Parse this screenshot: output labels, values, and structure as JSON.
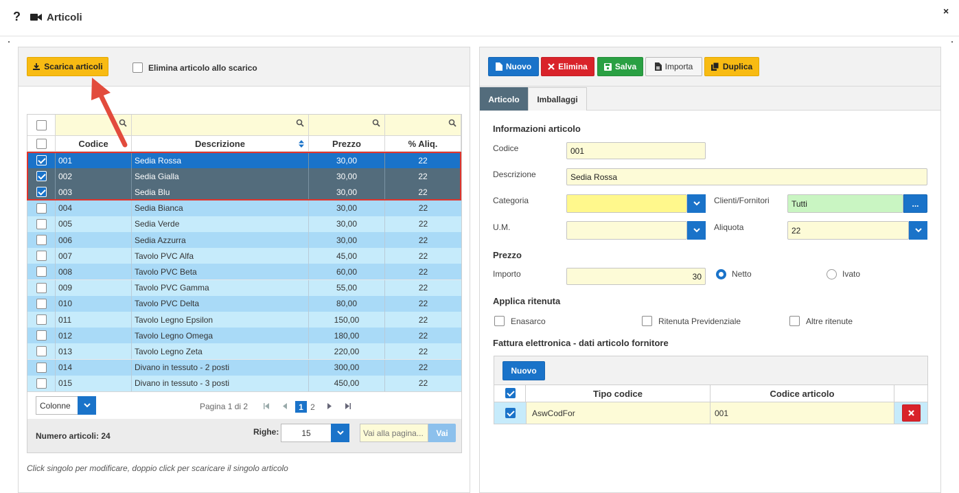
{
  "window": {
    "title": "Articoli",
    "help_label": "?",
    "close_label": "×"
  },
  "left": {
    "download_button": "Scarica articoli",
    "delete_on_download_label": "Elimina articolo allo scarico",
    "columns": {
      "code": "Codice",
      "description": "Descrizione",
      "price": "Prezzo",
      "vat": "% Aliq."
    },
    "rows": [
      {
        "code": "001",
        "description": "Sedia Rossa",
        "price": "30,00",
        "vat": "22",
        "checked": true
      },
      {
        "code": "002",
        "description": "Sedia Gialla",
        "price": "30,00",
        "vat": "22",
        "checked": true
      },
      {
        "code": "003",
        "description": "Sedia Blu",
        "price": "30,00",
        "vat": "22",
        "checked": true
      },
      {
        "code": "004",
        "description": "Sedia Bianca",
        "price": "30,00",
        "vat": "22",
        "checked": false
      },
      {
        "code": "005",
        "description": "Sedia Verde",
        "price": "30,00",
        "vat": "22",
        "checked": false
      },
      {
        "code": "006",
        "description": "Sedia Azzurra",
        "price": "30,00",
        "vat": "22",
        "checked": false
      },
      {
        "code": "007",
        "description": "Tavolo PVC Alfa",
        "price": "45,00",
        "vat": "22",
        "checked": false
      },
      {
        "code": "008",
        "description": "Tavolo PVC Beta",
        "price": "60,00",
        "vat": "22",
        "checked": false
      },
      {
        "code": "009",
        "description": "Tavolo PVC Gamma",
        "price": "55,00",
        "vat": "22",
        "checked": false
      },
      {
        "code": "010",
        "description": "Tavolo PVC Delta",
        "price": "80,00",
        "vat": "22",
        "checked": false
      },
      {
        "code": "011",
        "description": "Tavolo Legno Epsilon",
        "price": "150,00",
        "vat": "22",
        "checked": false
      },
      {
        "code": "012",
        "description": "Tavolo Legno Omega",
        "price": "180,00",
        "vat": "22",
        "checked": false
      },
      {
        "code": "013",
        "description": "Tavolo Legno Zeta",
        "price": "220,00",
        "vat": "22",
        "checked": false
      },
      {
        "code": "014",
        "description": "Divano in tessuto - 2 posti",
        "price": "300,00",
        "vat": "22",
        "checked": false
      },
      {
        "code": "015",
        "description": "Divano in tessuto - 3 posti",
        "price": "450,00",
        "vat": "22",
        "checked": false
      }
    ],
    "columns_select": "Colonne",
    "page_info": "Pagina 1 di 2",
    "pages": [
      "1",
      "2"
    ],
    "current_page": "1",
    "count_label": "Numero articoli: 24",
    "rows_label": "Righe:",
    "rows_value": "15",
    "goto_placeholder": "Vai alla pagina...",
    "goto_button": "Vai",
    "hint": "Click singolo per modificare, doppio click per scaricare il singolo articolo"
  },
  "right": {
    "toolbar": {
      "new": "Nuovo",
      "delete": "Elimina",
      "save": "Salva",
      "import": "Importa",
      "duplicate": "Duplica"
    },
    "tabs": [
      "Articolo",
      "Imballaggi"
    ],
    "info_section": "Informazioni articolo",
    "code_label": "Codice",
    "code_value": "001",
    "description_label": "Descrizione",
    "description_value": "Sedia Rossa",
    "category_label": "Categoria",
    "category_value": "",
    "clients_label": "Clienti/Fornitori",
    "clients_value": "Tutti",
    "clients_button": "...",
    "um_label": "U.M.",
    "um_value": "",
    "vat_label": "Aliquota",
    "vat_value": "22",
    "price_section": "Prezzo",
    "amount_label": "Importo",
    "amount_value": "30",
    "net_label": "Netto",
    "gross_label": "Ivato",
    "withholding_section": "Applica ritenuta",
    "enasarco_label": "Enasarco",
    "pension_label": "Ritenuta Previdenziale",
    "other_label": "Altre ritenute",
    "einvoice_section": "Fattura elettronica - dati articolo fornitore",
    "sub_new_button": "Nuovo",
    "sub_columns": {
      "type": "Tipo codice",
      "code": "Codice articolo"
    },
    "sub_row": {
      "type": "AswCodFor",
      "code": "001",
      "checked": true
    }
  },
  "colors": {
    "accent": "#1a73c9",
    "selected_row": "#536c7c",
    "row_odd": "#a9daf7",
    "row_even": "#c6ebfb",
    "highlight_border": "#e0342c",
    "yellow_button": "#f8bb13"
  }
}
